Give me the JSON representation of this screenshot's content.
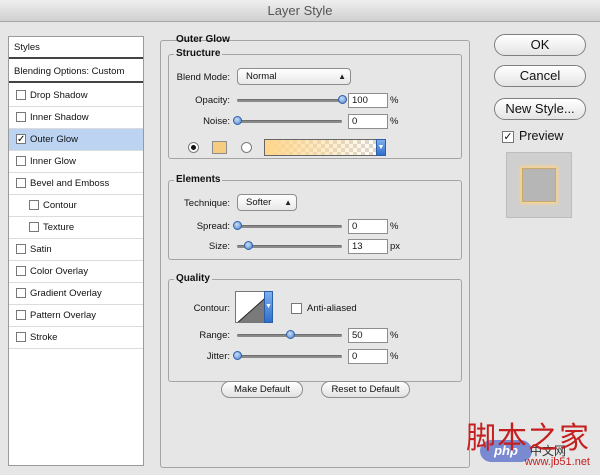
{
  "window": {
    "title": "Layer Style"
  },
  "styles_panel": {
    "header": "Styles",
    "blending": "Blending Options: Custom",
    "items": [
      {
        "label": "Drop Shadow",
        "checked": false,
        "selected": false
      },
      {
        "label": "Inner Shadow",
        "checked": false,
        "selected": false
      },
      {
        "label": "Outer Glow",
        "checked": true,
        "selected": true
      },
      {
        "label": "Inner Glow",
        "checked": false,
        "selected": false
      },
      {
        "label": "Bevel and Emboss",
        "checked": false,
        "selected": false
      },
      {
        "label": "Contour",
        "checked": false,
        "selected": false
      },
      {
        "label": "Texture",
        "checked": false,
        "selected": false
      },
      {
        "label": "Satin",
        "checked": false,
        "selected": false
      },
      {
        "label": "Color Overlay",
        "checked": false,
        "selected": false
      },
      {
        "label": "Gradient Overlay",
        "checked": false,
        "selected": false
      },
      {
        "label": "Pattern Overlay",
        "checked": false,
        "selected": false
      },
      {
        "label": "Stroke",
        "checked": false,
        "selected": false
      }
    ]
  },
  "outer_glow": {
    "title": "Outer Glow",
    "structure": {
      "title": "Structure",
      "blend_mode_label": "Blend Mode:",
      "blend_mode_value": "Normal",
      "opacity_label": "Opacity:",
      "opacity_value": "100",
      "opacity_unit": "%",
      "opacity_fraction": 1.0,
      "noise_label": "Noise:",
      "noise_value": "0",
      "noise_unit": "%",
      "noise_fraction": 0.0,
      "glow_color": "#f6cc80",
      "gradient_color": "#ffd68c",
      "solid_color_selected": true
    },
    "elements": {
      "title": "Elements",
      "technique_label": "Technique:",
      "technique_value": "Softer",
      "spread_label": "Spread:",
      "spread_value": "0",
      "spread_unit": "%",
      "spread_fraction": 0.0,
      "size_label": "Size:",
      "size_value": "13",
      "size_unit": "px",
      "size_fraction": 0.052
    },
    "quality": {
      "title": "Quality",
      "contour_label": "Contour:",
      "anti_aliased_label": "Anti-aliased",
      "anti_aliased_checked": false,
      "range_label": "Range:",
      "range_value": "50",
      "range_unit": "%",
      "range_fraction": 0.5,
      "jitter_label": "Jitter:",
      "jitter_value": "0",
      "jitter_unit": "%",
      "jitter_fraction": 0.0
    },
    "make_default": "Make Default",
    "reset_default": "Reset to Default"
  },
  "buttons": {
    "ok": "OK",
    "cancel": "Cancel",
    "new_style": "New Style...",
    "preview_label": "Preview",
    "preview_checked": true
  },
  "watermark": {
    "cn": "脚本之家",
    "url": "www.jb51.net",
    "php": "php",
    "zh": "中文网"
  },
  "icons": {
    "checkbox_checked": "check-icon",
    "dropdown": "updown-arrow-icon",
    "contour": "linear-contour-icon"
  }
}
